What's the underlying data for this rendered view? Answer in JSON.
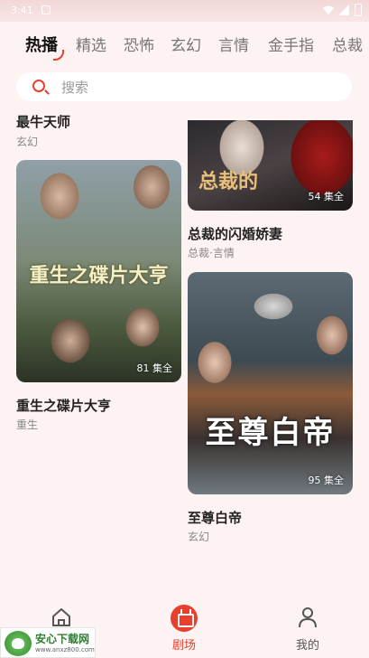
{
  "status_bar": {
    "time": "3:41"
  },
  "tabs": [
    {
      "label": "热播",
      "active": true
    },
    {
      "label": "精选",
      "active": false
    },
    {
      "label": "恐怖",
      "active": false
    },
    {
      "label": "玄幻",
      "active": false
    },
    {
      "label": "言情",
      "active": false
    },
    {
      "label": "金手指",
      "active": false
    },
    {
      "label": "总裁",
      "active": false
    }
  ],
  "search": {
    "placeholder": "搜索"
  },
  "feed": {
    "left": [
      {
        "title": "最牛天师",
        "tags": "玄幻"
      },
      {
        "title": "重生之碟片大亨",
        "tags": "重生",
        "episodes": "81 集全",
        "poster_text": "重生之碟片大亨"
      }
    ],
    "right": [
      {
        "title": "总裁的闪婚娇妻",
        "tags": "总裁·言情",
        "episodes": "54 集全",
        "poster_text": "总裁的"
      },
      {
        "title": "至尊白帝",
        "tags": "玄幻",
        "episodes": "95 集全",
        "poster_text": "至尊白帝"
      }
    ]
  },
  "bottom_nav": [
    {
      "label": "",
      "icon": "home-icon",
      "active": false
    },
    {
      "label": "剧场",
      "icon": "theater-icon",
      "active": true
    },
    {
      "label": "我的",
      "icon": "user-icon",
      "active": false
    }
  ],
  "watermark": {
    "name": "安心下载网",
    "url": "www.anxz800.com"
  },
  "colors": {
    "accent": "#e8402c",
    "background": "#fdf3f3"
  }
}
